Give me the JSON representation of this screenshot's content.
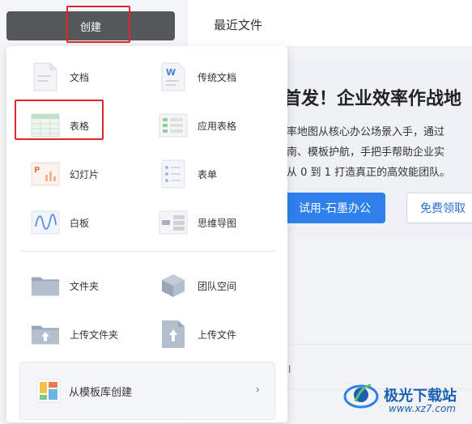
{
  "header": {
    "create_label": "创建",
    "recent_tab": "最近文件"
  },
  "menu": {
    "items": [
      {
        "label": "文档",
        "icon": "doc-icon"
      },
      {
        "label": "传统文档",
        "icon": "word-doc-icon"
      },
      {
        "label": "表格",
        "icon": "sheet-icon"
      },
      {
        "label": "应用表格",
        "icon": "app-sheet-icon"
      },
      {
        "label": "幻灯片",
        "icon": "slides-icon"
      },
      {
        "label": "表单",
        "icon": "form-icon"
      },
      {
        "label": "白板",
        "icon": "whiteboard-icon"
      },
      {
        "label": "思维导图",
        "icon": "mindmap-icon"
      },
      {
        "label": "文件夹",
        "icon": "folder-icon"
      },
      {
        "label": "团队空间",
        "icon": "team-space-icon"
      },
      {
        "label": "上传文件夹",
        "icon": "upload-folder-icon"
      },
      {
        "label": "上传文件",
        "icon": "upload-file-icon"
      }
    ],
    "template": {
      "label": "从模板库创建",
      "chevron": "›",
      "icon": "template-icon"
    }
  },
  "banner": {
    "title": "首发！企业效率作战地",
    "lines": [
      "率地图从核心办公场景入手，通过",
      "南、模板护航，手把手帮助企业实",
      "从 0 到 1 打造真正的高效能团队。"
    ],
    "primary_button": "试用-石墨办公",
    "secondary_button": "免费领取"
  },
  "list": {
    "dot": "l"
  },
  "watermark": {
    "site": "极光下载站",
    "url": "www.xz7.com"
  },
  "colors": {
    "create_bg": "#55575b",
    "highlight": "#e0262b",
    "primary": "#2f80ed"
  }
}
